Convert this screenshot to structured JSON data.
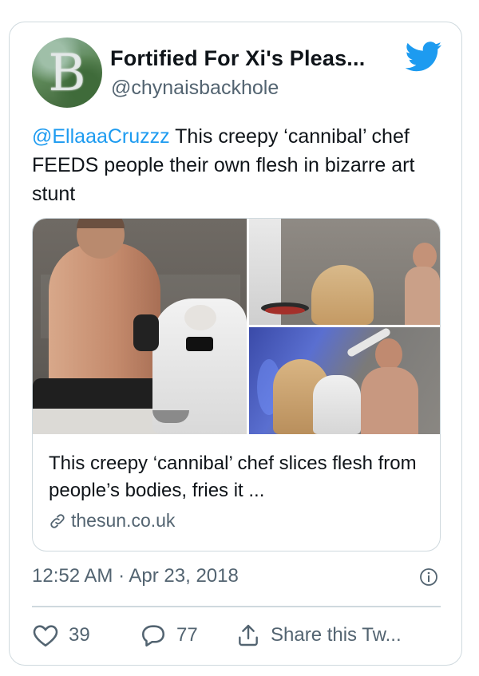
{
  "author": {
    "display_name": "Fortified For Xi's Pleas...",
    "handle": "@chynaisbackhole"
  },
  "tweet": {
    "mention": "@EllaaaCruzzz",
    "text": " This creepy ‘cannibal’ chef FEEDS people their own flesh in bizarre art stunt"
  },
  "link_card": {
    "title": "This creepy ‘cannibal’ chef slices flesh from people’s bodies, fries it ...",
    "domain": "thesun.co.uk"
  },
  "meta": {
    "timestamp": "12:52 AM · Apr 23, 2018"
  },
  "actions": {
    "likes": "39",
    "replies": "77",
    "share_label": "Share this Tw..."
  },
  "colors": {
    "accent": "#1d9bf0",
    "muted": "#536471",
    "border": "#cfd9de"
  },
  "icons": [
    "twitter-bird-icon",
    "info-icon",
    "link-icon",
    "heart-icon",
    "reply-icon",
    "share-icon"
  ]
}
